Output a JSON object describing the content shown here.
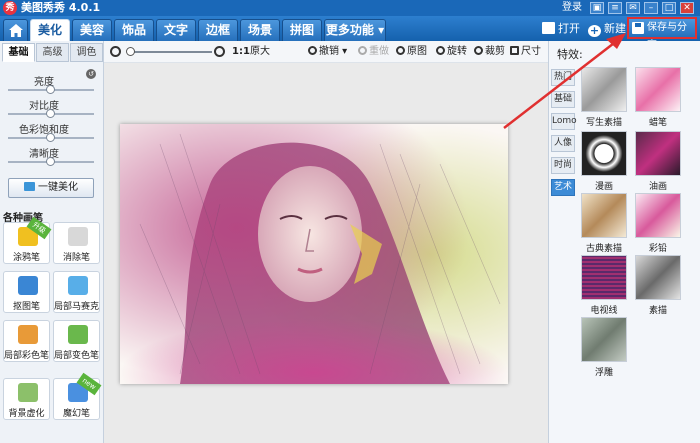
{
  "app": {
    "logo": "秀",
    "title": "美图秀秀 4.0.1",
    "login": "登录"
  },
  "menu": {
    "tabs": [
      "美化",
      "美容",
      "饰品",
      "文字",
      "边框",
      "场景",
      "拼图",
      "更多功能 ▾"
    ],
    "open_label": "打开",
    "new_label": "新建",
    "save_label": "保存与分享"
  },
  "left": {
    "subtabs": [
      "基础",
      "高级",
      "调色"
    ],
    "sliders": [
      "亮度",
      "对比度",
      "色彩饱和度",
      "清晰度"
    ],
    "one_key": "一键美化",
    "section_title": "各种画笔",
    "tools": [
      {
        "label": "涂鸦笔",
        "badge": "升级",
        "color": "#f0c020"
      },
      {
        "label": "消除笔",
        "color": "#d8d8d8"
      },
      {
        "label": "抠图笔",
        "color": "#3a86d4"
      },
      {
        "label": "局部马赛克",
        "color": "#58aee8"
      },
      {
        "label": "局部彩色笔",
        "color": "#e89a38"
      },
      {
        "label": "局部变色笔",
        "color": "#6ab84c"
      },
      {
        "label": "背景虚化",
        "color": "#8cc06a"
      },
      {
        "label": "魔幻笔",
        "badge": "new",
        "color": "#4a90e0"
      }
    ]
  },
  "toolbar": {
    "zoom_ratio": "1:1",
    "original_size": "原大",
    "undo": "撤销",
    "redo": "重做",
    "original": "原图",
    "rotate": "旋转",
    "crop": "裁剪",
    "size": "尺寸"
  },
  "right": {
    "title": "特效:",
    "categories": [
      "热门",
      "基础",
      "Lomo",
      "人像",
      "时尚",
      "艺术"
    ],
    "active_category": "艺术",
    "effects": [
      "写生素描",
      "蜡笔",
      "漫画",
      "油画",
      "古典素描",
      "彩铅",
      "电视线",
      "素描",
      "浮雕"
    ]
  },
  "colors": {
    "accent": "#1a68b8",
    "highlight": "#e03030"
  }
}
